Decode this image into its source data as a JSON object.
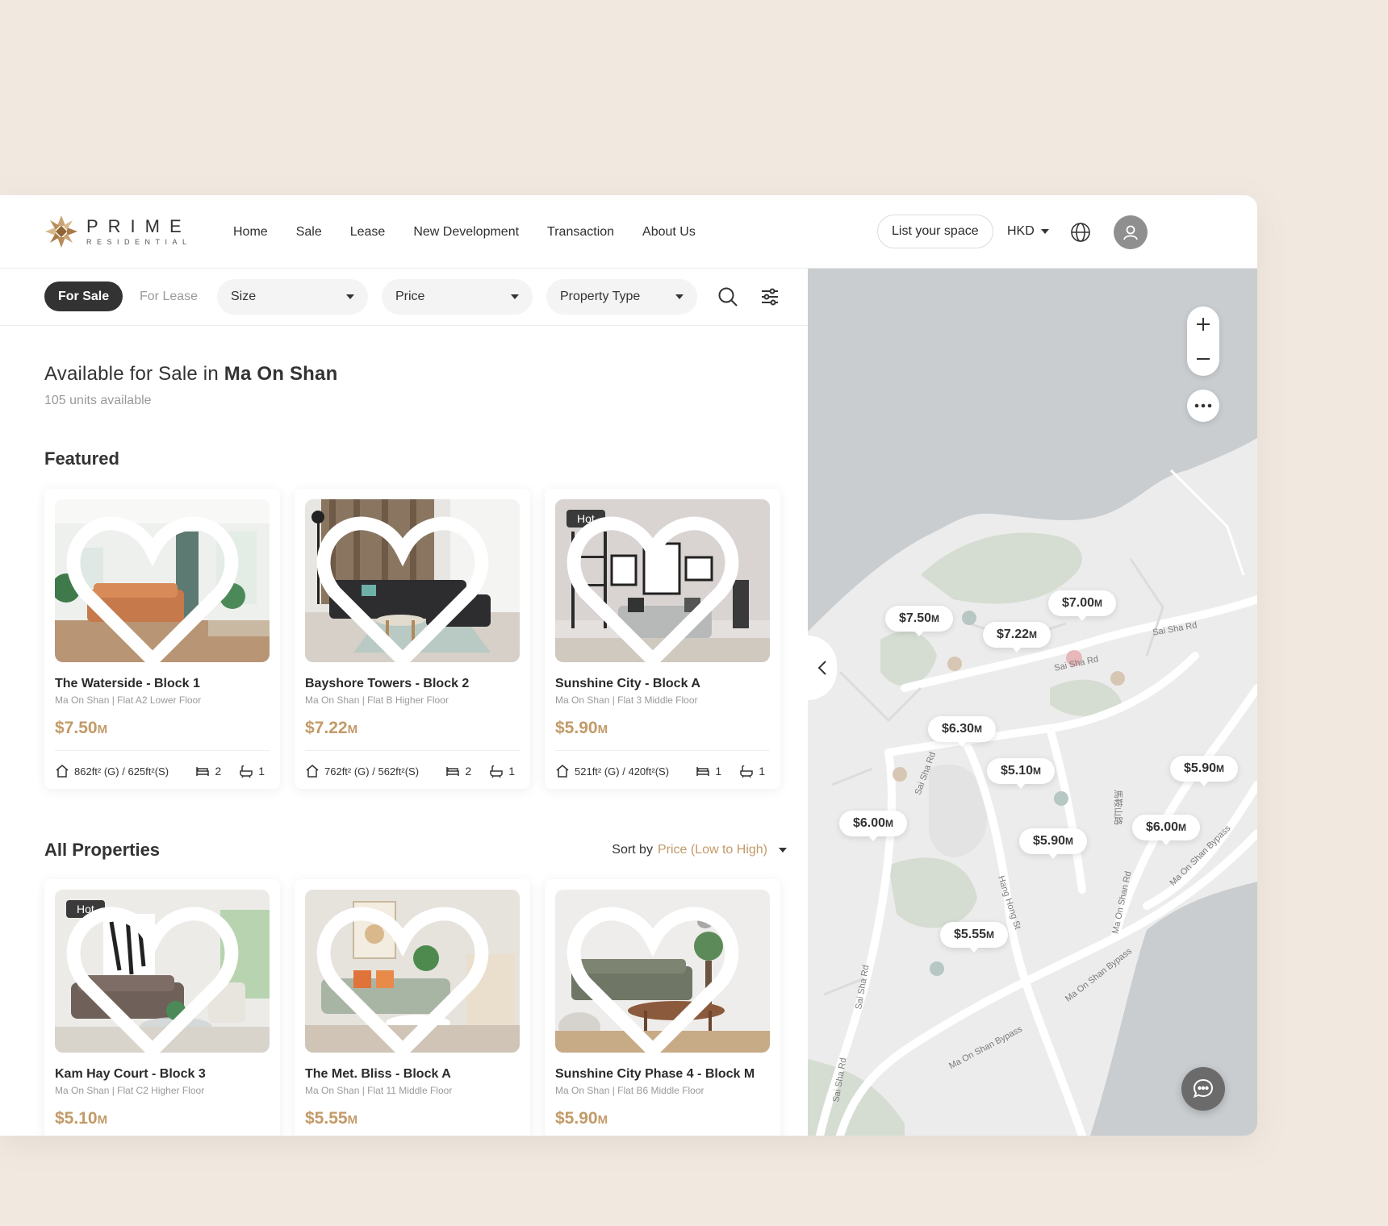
{
  "brand": {
    "name": "PRIME",
    "tagline": "RESIDENTIAL"
  },
  "nav": [
    "Home",
    "Sale",
    "Lease",
    "New Development",
    "Transaction",
    "About Us"
  ],
  "header": {
    "list_space": "List your space",
    "currency": "HKD"
  },
  "filters": {
    "for_sale": "For Sale",
    "for_lease": "For Lease",
    "size": "Size",
    "price": "Price",
    "property_type": "Property Type"
  },
  "listing": {
    "title_prefix": "Available for Sale in ",
    "title_location": "Ma On Shan",
    "count": "105 units available",
    "featured_heading": "Featured",
    "all_heading": "All Properties",
    "sort_label": "Sort by ",
    "sort_value": "Price (Low to High)"
  },
  "featured": [
    {
      "name": "The Waterside - Block 1",
      "addr": "Ma On Shan | Flat A2 Lower Floor",
      "price": "$7.50",
      "unit": "M",
      "size": "862ft² (G) / 625ft²(S)",
      "beds": "2",
      "baths": "1",
      "hot": ""
    },
    {
      "name": "Bayshore Towers - Block 2",
      "addr": "Ma On Shan | Flat B Higher Floor",
      "price": "$7.22",
      "unit": "M",
      "size": "762ft² (G) / 562ft²(S)",
      "beds": "2",
      "baths": "1",
      "hot": ""
    },
    {
      "name": "Sunshine City - Block A",
      "addr": "Ma On Shan | Flat 3 Middle Floor",
      "price": "$5.90",
      "unit": "M",
      "size": "521ft² (G) / 420ft²(S)",
      "beds": "1",
      "baths": "1",
      "hot": "Hot"
    }
  ],
  "all": [
    {
      "name": "Kam Hay Court - Block 3",
      "addr": "Ma On Shan | Flat C2 Higher Floor",
      "price": "$5.10",
      "unit": "M",
      "hot": "Hot"
    },
    {
      "name": "The Met. Bliss - Block A",
      "addr": "Ma On Shan | Flat 11 Middle Floor",
      "price": "$5.55",
      "unit": "M",
      "hot": ""
    },
    {
      "name": "Sunshine City Phase 4 - Block M",
      "addr": "Ma On Shan | Flat B6 Middle Floor",
      "price": "$5.90",
      "unit": "M",
      "hot": ""
    }
  ],
  "map": {
    "pins": [
      {
        "price": "$7.50",
        "unit": "M"
      },
      {
        "price": "$7.00",
        "unit": "M"
      },
      {
        "price": "$7.22",
        "unit": "M"
      },
      {
        "price": "$6.30",
        "unit": "M"
      },
      {
        "price": "$5.10",
        "unit": "M"
      },
      {
        "price": "$5.90",
        "unit": "M"
      },
      {
        "price": "$6.00",
        "unit": "M"
      },
      {
        "price": "$5.90",
        "unit": "M"
      },
      {
        "price": "$6.00",
        "unit": "M"
      },
      {
        "price": "$5.55",
        "unit": "M"
      }
    ],
    "roads": [
      "Sai Sha Rd",
      "Sai Sha Rd",
      "Sai Sha Rd",
      "Hang Hong St",
      "Ma On Shan Rd",
      "Ma On Shan Bypass",
      "Ma On Shan Bypass",
      "Ma On Shan Bypass",
      "Sai Sha Rd",
      "Sai Sha Rd",
      "馬鞍山路"
    ]
  },
  "colors": {
    "accent": "#c29a68",
    "dark": "#333333",
    "map_water": "#c9cdd0",
    "map_land": "#ececec"
  }
}
